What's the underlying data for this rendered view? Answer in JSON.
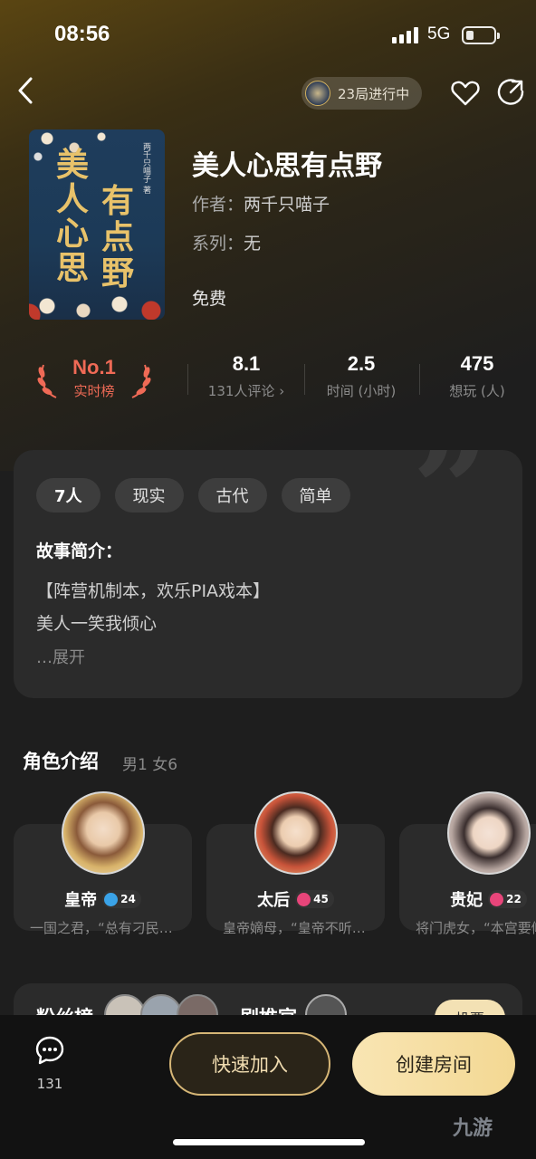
{
  "status_bar": {
    "time": "08:56",
    "network": "5G"
  },
  "header": {
    "playing_label": "23局进行中"
  },
  "book": {
    "title": "美人心思有点野",
    "author_key": "作者：",
    "author": "两千只喵子",
    "series_key": "系列：",
    "series": "无",
    "price": "免费",
    "cover_title_chars": [
      "美",
      "人",
      "心",
      "思",
      "有",
      "点",
      "野"
    ],
    "cover_author": "两千只喵子 著"
  },
  "stats": {
    "rank": {
      "value": "No.1",
      "label": "实时榜"
    },
    "rating": {
      "value": "8.1",
      "label": "131人评论 ›"
    },
    "time": {
      "value": "2.5",
      "label": "时间 (小时)"
    },
    "want": {
      "value": "475",
      "label": "想玩 (人)"
    }
  },
  "intro": {
    "tags": [
      "7人",
      "现实",
      "古代",
      "简单"
    ],
    "heading": "故事简介：",
    "lines": [
      "【阵营机制本，欢乐PIA戏本】",
      "美人一笑我倾心"
    ],
    "expand": "…展开"
  },
  "roles": {
    "title": "角色介绍",
    "subtitle": "男1 女6",
    "items": [
      {
        "name": "皇帝",
        "count": "24",
        "gender_color": "#3aa3e8",
        "desc": "一国之君，“总有刁民…"
      },
      {
        "name": "太后",
        "count": "45",
        "gender_color": "#e8457a",
        "desc": "皇帝嫡母，“皇帝不听…"
      },
      {
        "name": "贵妃",
        "count": "22",
        "gender_color": "#e8457a",
        "desc": "将门虎女，“本宫要倾"
      }
    ]
  },
  "fans": {
    "title": "粉丝榜",
    "rec_title": "剧推官",
    "vote": "投票"
  },
  "bottom": {
    "chat_count": "131",
    "quick_join": "快速加入",
    "create_room": "创建房间"
  },
  "watermark": "九游",
  "colors": {
    "accent_gold": "#f3d893",
    "rank_red": "#ef6a56",
    "card_bg": "#2b2b2b"
  }
}
